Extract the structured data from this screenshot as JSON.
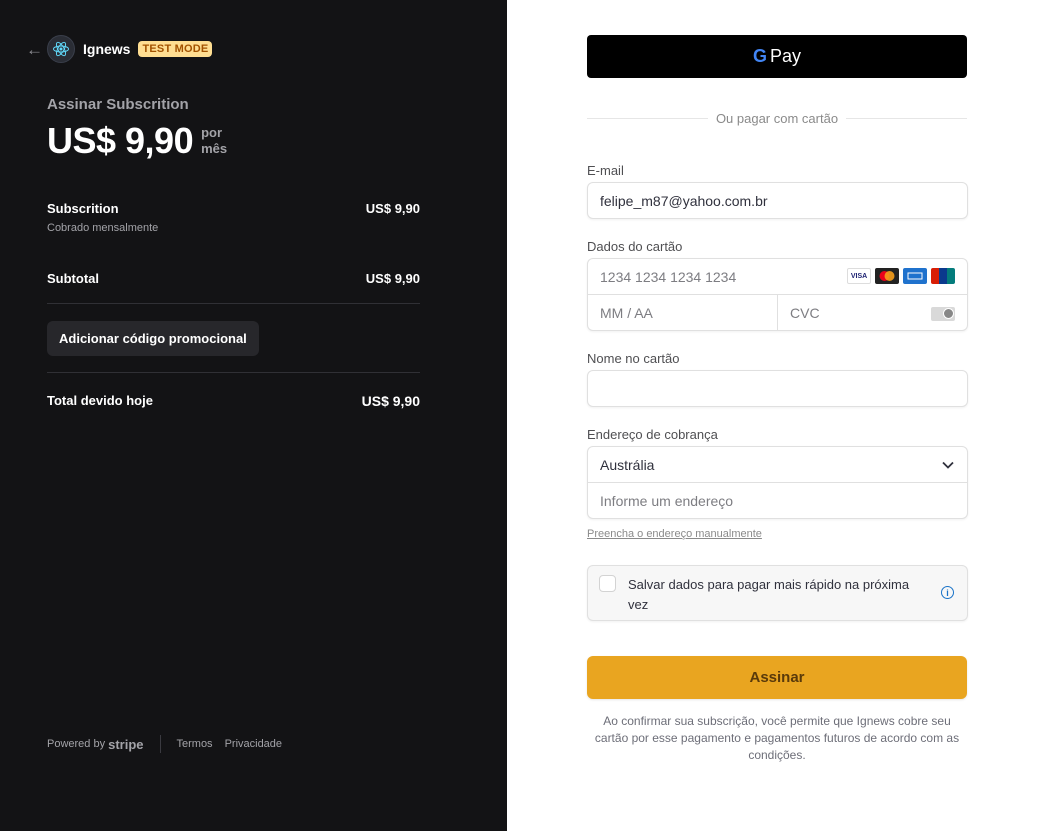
{
  "header": {
    "back_icon": "arrow-left-icon",
    "logo_icon": "react-atom-icon",
    "brand": "Ignews",
    "test_mode": "TEST MODE"
  },
  "summary": {
    "subscribe_title": "Assinar Subscrition",
    "price": "US$ 9,90",
    "per": "por mês",
    "items": [
      {
        "name": "Subscrition",
        "note": "Cobrado mensalmente",
        "amount": "US$ 9,90"
      }
    ],
    "subtotal_label": "Subtotal",
    "subtotal_amount": "US$ 9,90",
    "promo_label": "Adicionar código promocional",
    "total_label": "Total devido hoje",
    "total_amount": "US$ 9,90"
  },
  "footer": {
    "powered_by": "Powered by",
    "stripe": "stripe",
    "terms": "Termos",
    "privacy": "Privacidade"
  },
  "payment": {
    "gpay_g": "G",
    "gpay_pay": "Pay",
    "or_text": "Ou pagar com cartão",
    "email_label": "E-mail",
    "email_value": "felipe_m87@yahoo.com.br",
    "card_label": "Dados do cartão",
    "card_number_placeholder": "1234 1234 1234 1234",
    "expiry_placeholder": "MM / AA",
    "cvc_placeholder": "CVC",
    "card_brands": [
      "VISA",
      "MC",
      "AMEX",
      "UP"
    ],
    "name_label": "Nome no cartão",
    "name_value": "",
    "address_label": "Endereço de cobrança",
    "country_value": "Austrália",
    "address_placeholder": "Informe um endereço",
    "manual_link": "Preencha o endereço manualmente",
    "save_text": "Salvar dados para pagar mais rápido na próxima vez",
    "info_icon": "info-icon",
    "submit_label": "Assinar",
    "terms_text": "Ao confirmar sua subscrição, você permite que Ignews cobre seu cartão por esse pagamento e pagamentos futuros de acordo com as condições."
  },
  "colors": {
    "left_bg": "#131315",
    "accent": "#e9a520",
    "test_mode_bg": "#ffde92"
  }
}
